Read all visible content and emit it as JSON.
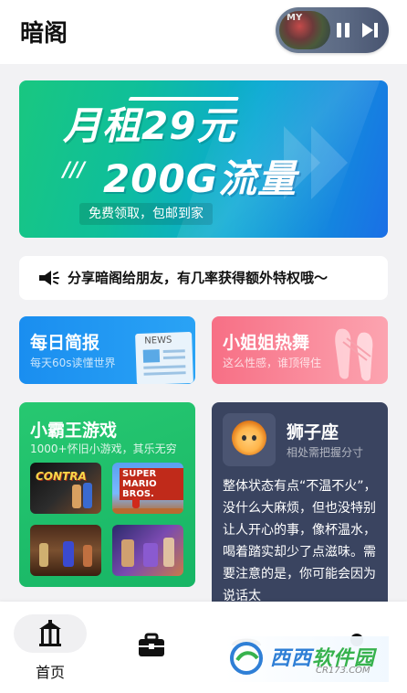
{
  "app": {
    "title": "暗阁"
  },
  "player": {
    "cover_text": "MY"
  },
  "banner": {
    "line1": "月租29元",
    "line2": "200G流量",
    "subtitle": "免费领取，包邮到家"
  },
  "notice": {
    "text": "分享暗阁给朋友，有几率获得额外特权哦～"
  },
  "cards": {
    "news": {
      "title": "每日简报",
      "subtitle": "每天60s读懂世界",
      "paper_label": "NEWS"
    },
    "dance": {
      "title": "小姐姐热舞",
      "subtitle": "这么性感，谁顶得住"
    },
    "games": {
      "title": "小霸王游戏",
      "subtitle": "1000+怀旧小游戏，其乐无穷",
      "thumbs": [
        {
          "label": "CONTRA"
        },
        {
          "label": "SUPER MARIO BROS."
        }
      ]
    },
    "horoscope": {
      "title": "狮子座",
      "subtitle": "相处需把握分寸",
      "text": "整体状态有点“不温不火”，没什么大麻烦，但也没特别让人开心的事，像杯温水，喝着踏实却少了点滋味。需要注意的是，你可能会因为说话太"
    }
  },
  "tabbar": {
    "home_label": "首页"
  },
  "watermark": {
    "brand_a": "西西",
    "brand_b": "软件园",
    "domain": "CR173.COM"
  },
  "colors": {
    "news": "#1a8ef0",
    "dance": "#f76f85",
    "games": "#27c871",
    "horoscope": "#3a4460"
  }
}
